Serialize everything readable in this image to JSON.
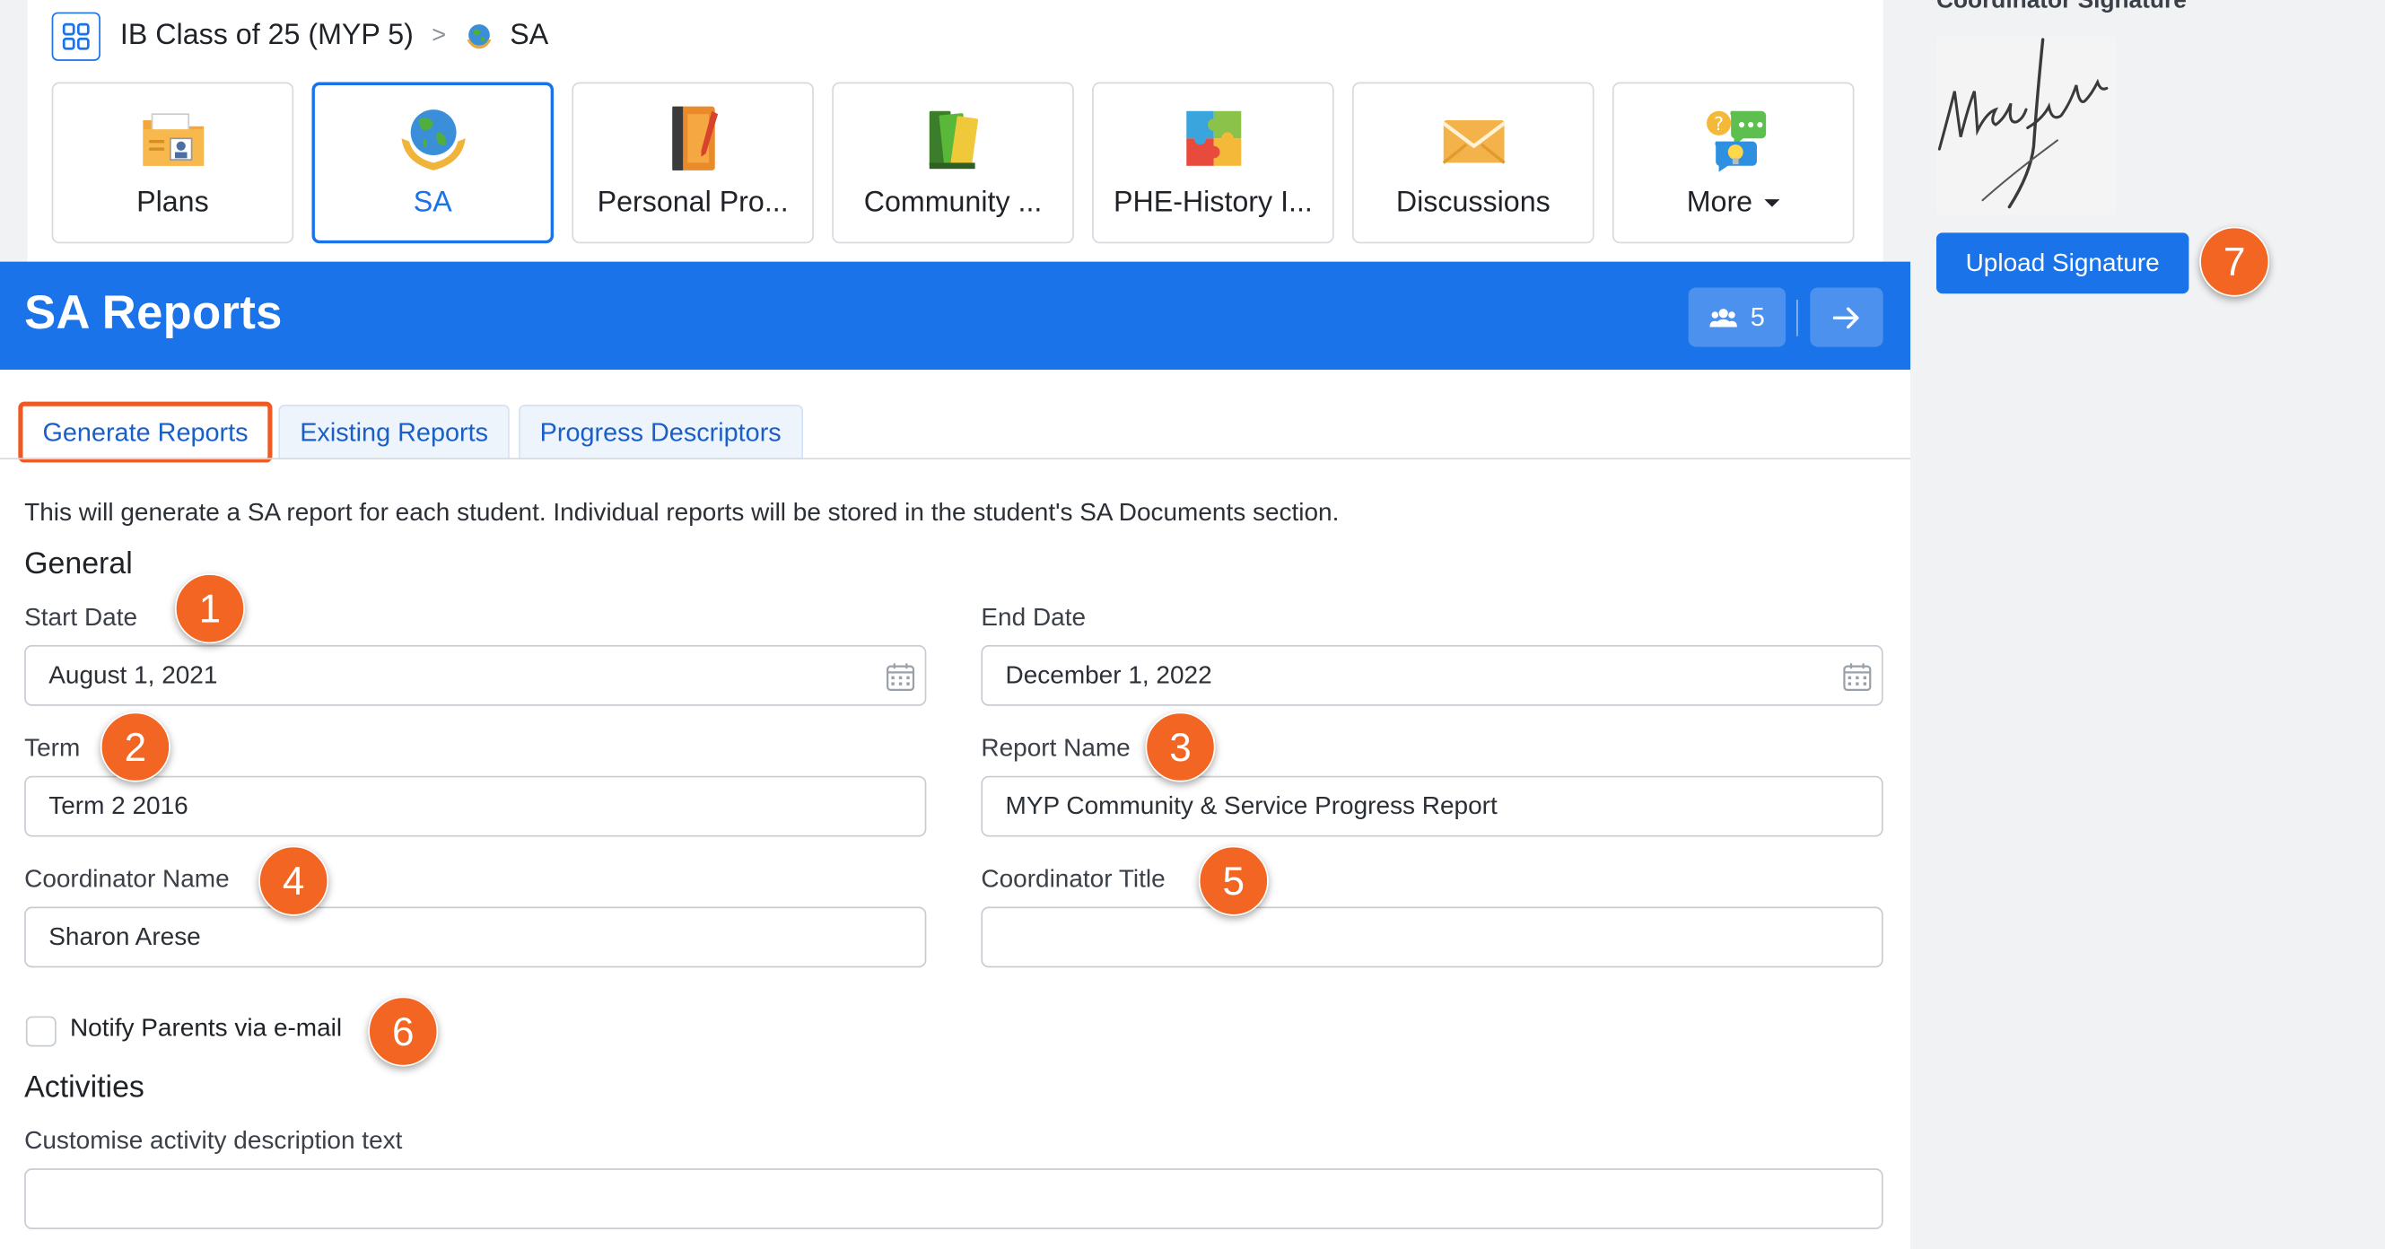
{
  "breadcrumb": {
    "class_name": "IB Class of 25 (MYP 5)",
    "separator": ">",
    "current": "SA"
  },
  "tiles": [
    {
      "label": "Plans",
      "icon": "plans-folder-icon"
    },
    {
      "label": "SA",
      "icon": "globe-hands-icon",
      "active": true
    },
    {
      "label": "Personal Pro...",
      "icon": "notebook-pencil-icon"
    },
    {
      "label": "Community ...",
      "icon": "books-icon"
    },
    {
      "label": "PHE-History I...",
      "icon": "puzzle-icon"
    },
    {
      "label": "Discussions",
      "icon": "envelope-icon"
    },
    {
      "label": "More",
      "icon": "chat-lightbulb-icon"
    }
  ],
  "panel": {
    "title": "SA Reports",
    "member_count": "5",
    "accent": "#1a73e8"
  },
  "tabs": [
    {
      "label": "Generate Reports",
      "active": true
    },
    {
      "label": "Existing Reports"
    },
    {
      "label": "Progress Descriptors"
    }
  ],
  "intro": "This will generate a SA report for each student. Individual reports will be stored in the student's SA Documents section.",
  "general": {
    "heading": "General",
    "start_date": {
      "label": "Start Date",
      "value": "August 1, 2021"
    },
    "end_date": {
      "label": "End Date",
      "value": "December 1, 2022"
    },
    "term": {
      "label": "Term",
      "value": "Term 2 2016"
    },
    "report_name": {
      "label": "Report Name",
      "value": "MYP Community & Service Progress Report"
    },
    "coordinator_name": {
      "label": "Coordinator Name",
      "value": "Sharon Arese"
    },
    "coordinator_title": {
      "label": "Coordinator Title",
      "value": ""
    },
    "notify_parents": {
      "label": "Notify Parents via e-mail",
      "checked": false
    }
  },
  "activities": {
    "heading": "Activities",
    "description_label": "Customise activity description text",
    "description_value": ""
  },
  "sidebar": {
    "signature_title": "Coordinator Signature",
    "upload_button": "Upload Signature"
  },
  "markers": [
    "1",
    "2",
    "3",
    "4",
    "5",
    "6",
    "7"
  ],
  "colors": {
    "marker": "#f26522",
    "highlight_outline": "#ee5a24",
    "primary": "#1a73e8"
  }
}
